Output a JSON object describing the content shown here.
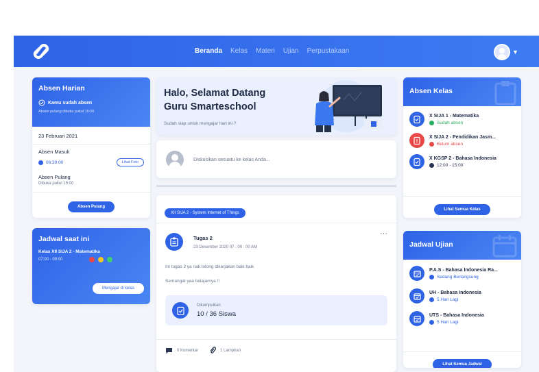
{
  "nav": {
    "items": [
      {
        "label": "Beranda",
        "active": true
      },
      {
        "label": "Kelas",
        "active": false
      },
      {
        "label": "Materi",
        "active": false
      },
      {
        "label": "Ujian",
        "active": false
      },
      {
        "label": "Perpustakaan",
        "active": false
      }
    ]
  },
  "absen_harian": {
    "title": "Absen Harian",
    "status": "Kamu sudah absen",
    "note": "Absen pulang dibuka pukul 15:00",
    "date": "23 Februari 2021",
    "masuk_label": "Absen Masuk",
    "masuk_time": "06:30:00",
    "foto_button": "Lihat Foto",
    "pulang_label": "Absen Pulang",
    "pulang_note": "Dibuka pukul 15:00",
    "pulang_button": "Absen Pulang"
  },
  "jadwal_saat_ini": {
    "title": "Jadwal saat ini",
    "kelas": "Kelas XII SIJA 2 - Matematika",
    "time": "07:00 - 09:00",
    "button": "Mengajar di kelas"
  },
  "welcome": {
    "line1": "Halo, Selamat Datang",
    "line2": "Guru Smarteschool",
    "subtitle": "Sudah siap untuk mengajar hari ini ?"
  },
  "discussion": {
    "placeholder": "Diskusikan sesuatu ke kelas Anda..."
  },
  "post": {
    "class_tag": "XII SIJA 2 - System Internet of Things",
    "title": "Tugas 2",
    "date": "23 Desember 2020 07 : 00 : 00 AM",
    "text1": "Ini tugas 3 ya nak tolong dikerjakan baik baik",
    "text2": "Semangat yaa belajarnya !!",
    "collected_label": "Dikumpulkan",
    "collected_value": "10 / 36 Siswa",
    "comments": "0 Komentar",
    "attachments": "1 Lampiran",
    "more": "···"
  },
  "absen_kelas": {
    "title": "Absen Kelas",
    "items": [
      {
        "name": "X SIJA 1 - Matematika",
        "status": "Sudah absen",
        "type": "ok"
      },
      {
        "name": "X SIJA 2 - Pendidikan Jasm...",
        "status": "Belum absen",
        "type": "bad"
      },
      {
        "name": "X KGSP 2 - Bahasa Indonesia",
        "status": "12:00 - 15:00",
        "type": "time"
      }
    ],
    "button": "Lihat Semua Kelas"
  },
  "jadwal_ujian": {
    "title": "Jadwal Ujian",
    "items": [
      {
        "name": "P.A.S - Bahasa Indonesia Ra...",
        "status": "Sedang Berlangsung"
      },
      {
        "name": "UH - Bahasa Indonesia",
        "status": "5 Hari Lagi"
      },
      {
        "name": "UTS - Bahasa Indonesia",
        "status": "5 Hari Lagi"
      }
    ],
    "button": "Lihat Semua Jadwal"
  },
  "colors": {
    "primary": "#2f63e6",
    "success": "#27ae60",
    "danger": "#e94848"
  }
}
